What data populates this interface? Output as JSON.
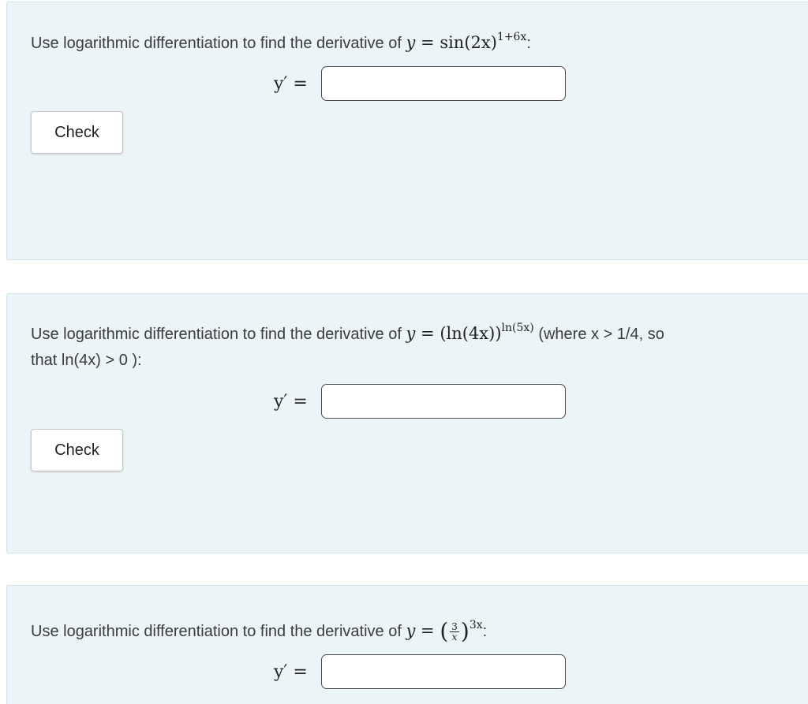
{
  "problems": [
    {
      "prompt_prefix": "Use logarithmic differentiation to find the derivative of",
      "expression": {
        "lhs": "y",
        "eq": "=",
        "base": "sin(2x)",
        "exponent": "1+6x",
        "suffix": ":"
      },
      "answer_label": "y′ =",
      "answer_value": "",
      "check_label": "Check"
    },
    {
      "prompt_prefix": "Use logarithmic differentiation to find the derivative of",
      "expression": {
        "lhs": "y",
        "eq": "=",
        "base": "(ln(4x))",
        "exponent": "ln(5x)",
        "suffix": ""
      },
      "condition_text": "(where x > 1/4, so",
      "continuation": "that ln(4x) > 0 ):",
      "answer_label": "y′ =",
      "answer_value": "",
      "check_label": "Check"
    },
    {
      "prompt_prefix": "Use logarithmic differentiation to find the derivative of",
      "expression": {
        "lhs": "y",
        "eq": "=",
        "frac_num": "3",
        "frac_den": "x",
        "exponent": "3x",
        "suffix": ":"
      },
      "answer_label": "y′ =",
      "answer_value": ""
    }
  ],
  "colors": {
    "panel_bg": "#ebf4f6",
    "panel_border": "#cfe3e8",
    "text": "#3b3b3b"
  }
}
